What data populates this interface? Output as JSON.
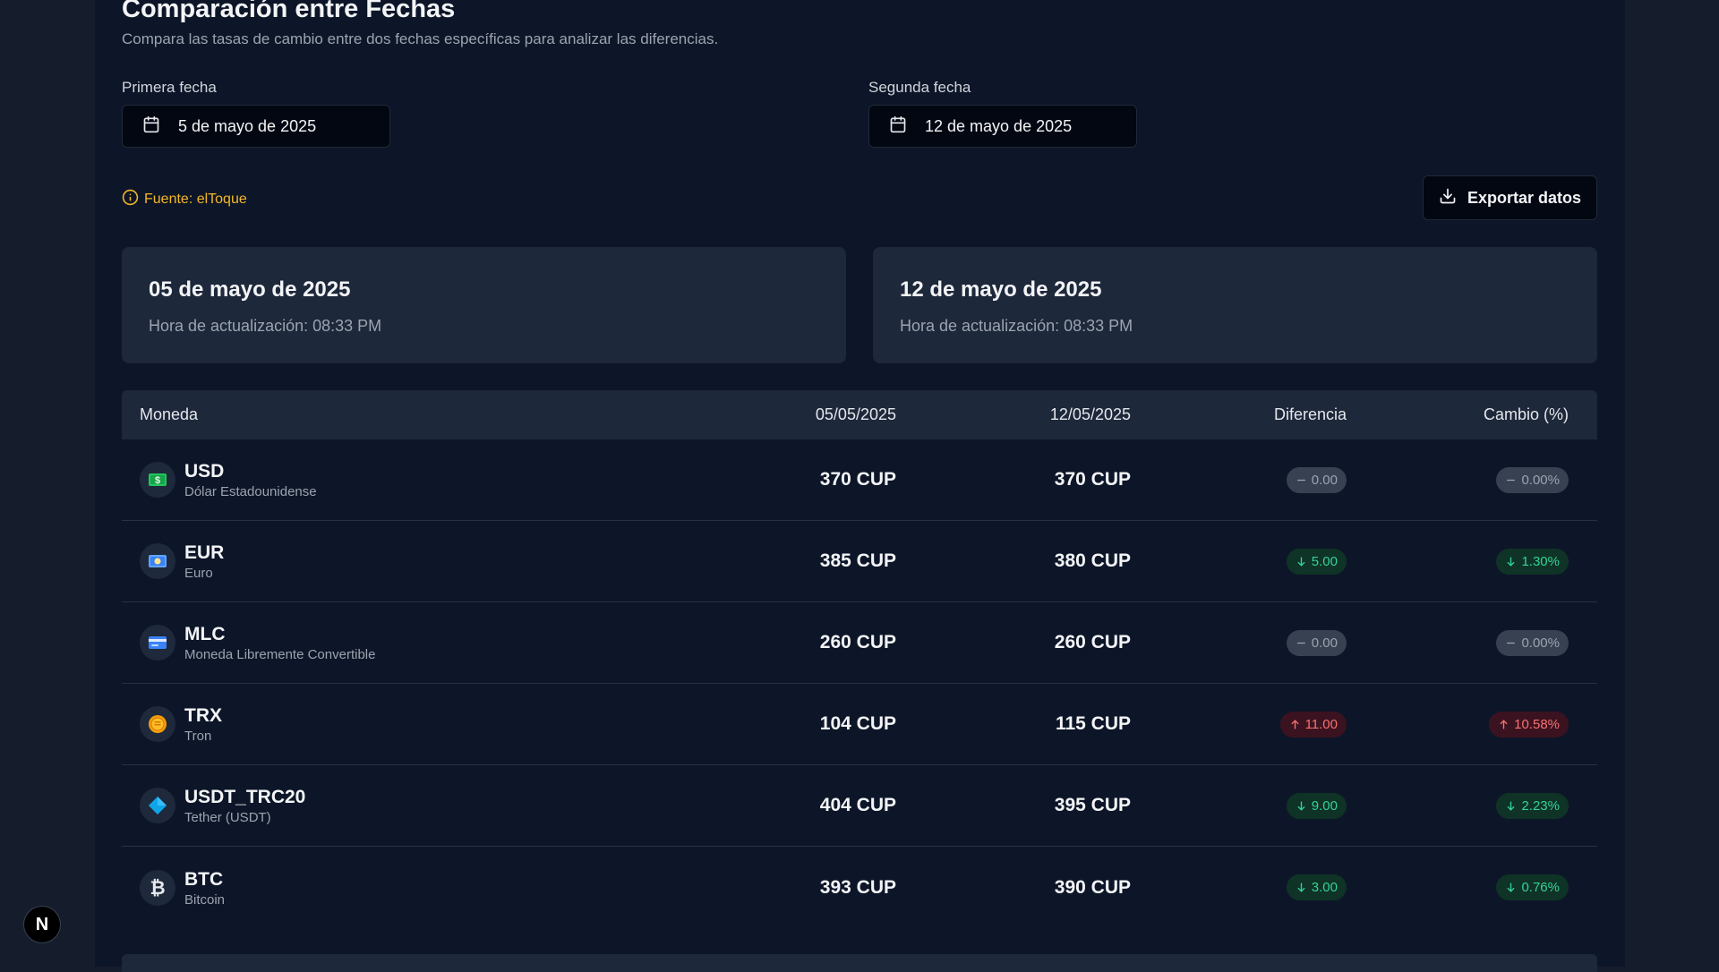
{
  "header": {
    "title": "Comparación entre Fechas",
    "subtitle": "Compara las tasas de cambio entre dos fechas específicas para analizar las diferencias."
  },
  "first_date": {
    "label": "Primera fecha",
    "value": "5 de mayo de 2025"
  },
  "second_date": {
    "label": "Segunda fecha",
    "value": "12 de mayo de 2025"
  },
  "source": {
    "text": "Fuente: elToque",
    "icon": "info-icon",
    "color": "#f5b627"
  },
  "export_button": {
    "label": "Exportar datos",
    "icon": "download-icon"
  },
  "cards": [
    {
      "date": "05 de mayo de 2025",
      "updated": "Hora de actualización: 08:33 PM"
    },
    {
      "date": "12 de mayo de 2025",
      "updated": "Hora de actualización: 08:33 PM"
    }
  ],
  "table": {
    "headers": [
      "Moneda",
      "05/05/2025",
      "12/05/2025",
      "Diferencia",
      "Cambio (%)"
    ],
    "rows": [
      {
        "code": "USD",
        "name": "Dólar Estadounidense",
        "icon": "banknote-icon",
        "v1": "370 CUP",
        "v2": "370 CUP",
        "diff": "0.00",
        "pct": "0.00%",
        "trend": "neutral"
      },
      {
        "code": "EUR",
        "name": "Euro",
        "icon": "euro-banknote-icon",
        "v1": "385 CUP",
        "v2": "380 CUP",
        "diff": "5.00",
        "pct": "1.30%",
        "trend": "down"
      },
      {
        "code": "MLC",
        "name": "Moneda Libremente Convertible",
        "icon": "credit-card-icon",
        "v1": "260 CUP",
        "v2": "260 CUP",
        "diff": "0.00",
        "pct": "0.00%",
        "trend": "neutral"
      },
      {
        "code": "TRX",
        "name": "Tron",
        "icon": "coin-icon",
        "v1": "104 CUP",
        "v2": "115 CUP",
        "diff": "11.00",
        "pct": "10.58%",
        "trend": "up"
      },
      {
        "code": "USDT_TRC20",
        "name": "Tether (USDT)",
        "icon": "diamond-icon",
        "v1": "404 CUP",
        "v2": "395 CUP",
        "diff": "9.00",
        "pct": "2.23%",
        "trend": "down"
      },
      {
        "code": "BTC",
        "name": "Bitcoin",
        "icon": "bitcoin-icon",
        "v1": "393 CUP",
        "v2": "390 CUP",
        "diff": "3.00",
        "pct": "0.76%",
        "trend": "down"
      }
    ]
  },
  "dev_badge": {
    "letter": "N"
  },
  "colors": {
    "panel": "#0d1628",
    "card": "#1d283b",
    "down": "#34d399",
    "up": "#f87171"
  }
}
